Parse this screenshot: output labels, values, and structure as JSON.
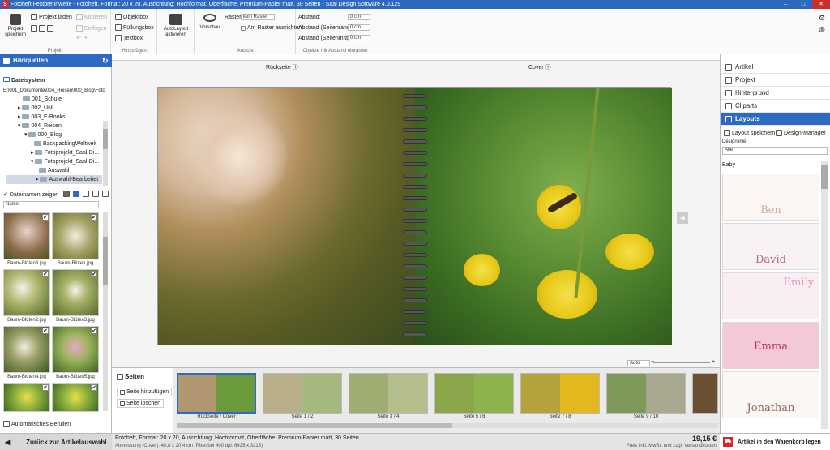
{
  "title": "Fotoheft Festbrennweite - Fotoheft, Format: 20 x 20, Ausrichtung: Hochformat, Oberfläche: Premium-Papier matt, 30 Seiten - Saal Design Software 4.0.129",
  "ribbon": {
    "projekt": {
      "save": "Projekt speichern",
      "load": "Projekt laden",
      "copy": "Kopieren",
      "paste": "Einfügen",
      "label": "Projekt"
    },
    "hinzu": {
      "obj": "Objektbox",
      "fill": "Füllungsbox",
      "text": "Textbox",
      "label": "Hinzufügen"
    },
    "auto": {
      "label": "AutoLayout aktivieren"
    },
    "ansicht": {
      "preview": "Vorschau",
      "raster": "Raster:",
      "raster_val": "kein Raster",
      "snap": "Am Raster ausrichten",
      "label": "Ansicht"
    },
    "abstand": {
      "a1": "Abstand:",
      "a2": "Abstand (Seitenrand):",
      "a3": "Abstand (Seitenmitte):",
      "v1": "0 cm",
      "v2": "0 cm",
      "v3": "0 cm",
      "label": "Objekte mit Abstand einrasten"
    }
  },
  "left": {
    "title": "Bildquellen",
    "filesystem": "Dateisystem",
    "path": "E:\\001_Dokumente\\004_Reisen\\000_Blog\\Foto",
    "tree": [
      "001_Schule",
      "002_UNI",
      "003_E-Books",
      "004_Reisen",
      "000_Blog",
      "BackpackingWeltweit",
      "Fotoprojekt_Saal-Di...",
      "Fotoprojekt_Saal-Di...",
      "Auswahl",
      "Auswahl-Bearbeitet"
    ],
    "show_names": "Dateinamen zeigen",
    "sort": "Name",
    "thumbs": [
      "Baum-Blüten3.jpg",
      "Baum-Blüten.jpg",
      "Baum-Blüten2.jpg",
      "Baum-Blüten3.jpg",
      "Baum-Blüten4.jpg",
      "Baum-Blüten5.jpg",
      "",
      ""
    ],
    "autofill": "Automatisches Befüllen"
  },
  "center": {
    "back": "Rückseite",
    "cover": "Cover",
    "zoom": "Auto"
  },
  "bottom": {
    "title": "Seiten",
    "add": "Seite hinzufügen",
    "del": "Seite löschen",
    "pages": [
      "Rückseite / Cover",
      "Seite 1 / 2",
      "Seite 3 / 4",
      "Seite 5 / 6",
      "Seite 7 / 8",
      "Seite 9 / 10"
    ]
  },
  "right": {
    "menu": [
      "Artikel",
      "Projekt",
      "Hintergrund",
      "Cliparts",
      "Layouts"
    ],
    "save": "Layout speichern",
    "manager": "Design-Manager",
    "line_label": "Designlinie:",
    "line_value": "Alle",
    "category": "Baby",
    "layouts": [
      "Ben",
      "David",
      "Emily",
      "Emma",
      "Jonathan"
    ]
  },
  "status": {
    "back": "Zurück zur Artikelauswahl",
    "info1": "Fotoheft, Format: 20 x 20, Ausrichtung: Hochformat, Oberfläche: Premium-Papier matt, 30 Seiten",
    "info2": "Abmessung (Cover): 40,8 x 20,4 cm (Pixel bei 400 dpi: 6425 x 3213)",
    "price": "19,15 €",
    "price_note": "Preis inkl. MwSt. und zzgl. Versandkosten",
    "cart": "Artikel in den Warenkorb legen"
  }
}
